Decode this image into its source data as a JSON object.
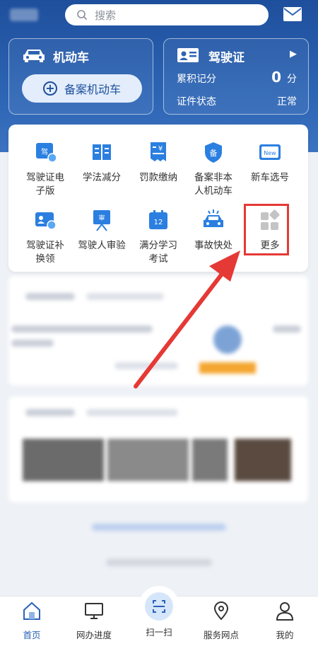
{
  "search": {
    "placeholder": "搜索"
  },
  "vehicle_card": {
    "title": "机动车",
    "register_button": "备案机动车"
  },
  "license_card": {
    "title": "驾驶证",
    "points_label": "累积记分",
    "points_value": "0",
    "points_unit": "分",
    "status_label": "证件状态",
    "status_value": "正常"
  },
  "menu": {
    "items": [
      {
        "label": "驾驶证电\n子版",
        "icon": "e-license-icon"
      },
      {
        "label": "学法减分",
        "icon": "book-icon"
      },
      {
        "label": "罚款缴纳",
        "icon": "fine-payment-icon"
      },
      {
        "label": "备案非本\n人机动车",
        "icon": "register-shield-icon"
      },
      {
        "label": "新车选号",
        "icon": "new-plate-icon"
      },
      {
        "label": "驾驶证补\n换领",
        "icon": "license-replace-icon"
      },
      {
        "label": "驾驶人审验",
        "icon": "driver-review-icon"
      },
      {
        "label": "满分学习\n考试",
        "icon": "calendar-exam-icon"
      },
      {
        "label": "事故快处",
        "icon": "accident-car-icon"
      },
      {
        "label": "更多",
        "icon": "more-grid-icon"
      }
    ]
  },
  "tabbar": {
    "items": [
      {
        "label": "首页",
        "icon": "home-icon"
      },
      {
        "label": "网办进度",
        "icon": "monitor-icon"
      },
      {
        "label": "扫一扫",
        "icon": "scan-icon"
      },
      {
        "label": "服务网点",
        "icon": "location-icon"
      },
      {
        "label": "我的",
        "icon": "user-icon"
      }
    ]
  },
  "colors": {
    "brand_blue": "#2a62b8",
    "highlight_red": "#e53935",
    "icon_blue": "#2b7fe0"
  }
}
